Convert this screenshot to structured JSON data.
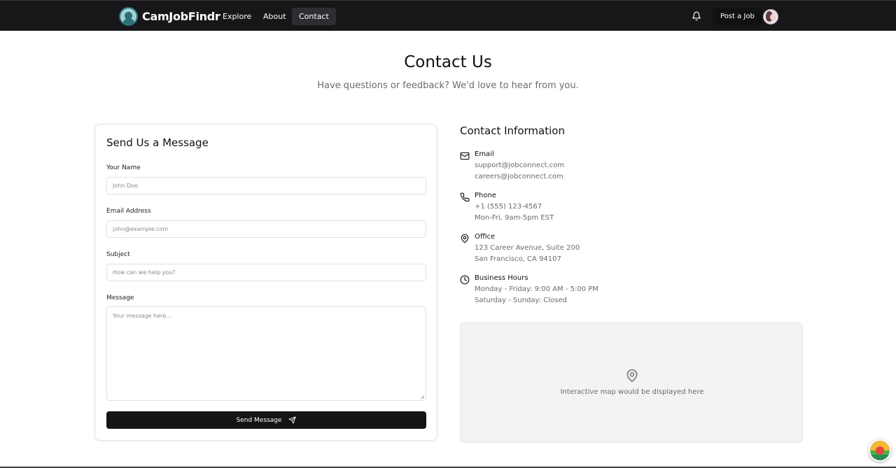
{
  "header": {
    "brand_name": "CamJobFindr",
    "nav": [
      {
        "label": "Explore"
      },
      {
        "label": "About"
      },
      {
        "label": "Contact",
        "active": true
      }
    ],
    "post_job_label": "Post a Job",
    "icons": [
      "logo-icon",
      "bell-icon",
      "avatar"
    ]
  },
  "hero": {
    "title": "Contact Us",
    "subtitle": "Have questions or feedback? We'd love to hear from you."
  },
  "form": {
    "heading": "Send Us a Message",
    "fields": {
      "name": {
        "label": "Your Name",
        "placeholder": "John Doe",
        "value": ""
      },
      "email": {
        "label": "Email Address",
        "placeholder": "john@example.com",
        "value": ""
      },
      "subject": {
        "label": "Subject",
        "placeholder": "How can we help you?",
        "value": ""
      },
      "message": {
        "label": "Message",
        "placeholder": "Your message here...",
        "value": ""
      }
    },
    "submit_label": "Send Message",
    "submit_icon": "send-icon"
  },
  "contact_info": {
    "heading": "Contact Information",
    "items": [
      {
        "icon": "mail-icon",
        "title": "Email",
        "lines": [
          "support@jobconnect.com",
          "careers@jobconnect.com"
        ]
      },
      {
        "icon": "phone-icon",
        "title": "Phone",
        "lines": [
          "+1 (555) 123-4567",
          "Mon-Fri, 9am-5pm EST"
        ]
      },
      {
        "icon": "map-pin-icon",
        "title": "Office",
        "lines": [
          "123 Career Avenue, Suite 200",
          "San Francisco, CA 94107"
        ]
      },
      {
        "icon": "clock-icon",
        "title": "Business Hours",
        "lines": [
          "Monday - Friday: 9:00 AM - 5:00 PM",
          "Saturday - Sunday: Closed"
        ]
      }
    ]
  },
  "map": {
    "icon": "map-pin-icon",
    "caption": "Interactive map would be displayed here"
  },
  "colors": {
    "header_bg": "#17171a",
    "accent_dark": "#141416",
    "muted_text": "#6b6b6b",
    "border": "#e2e2e2",
    "map_bg": "#f3f3f3"
  }
}
